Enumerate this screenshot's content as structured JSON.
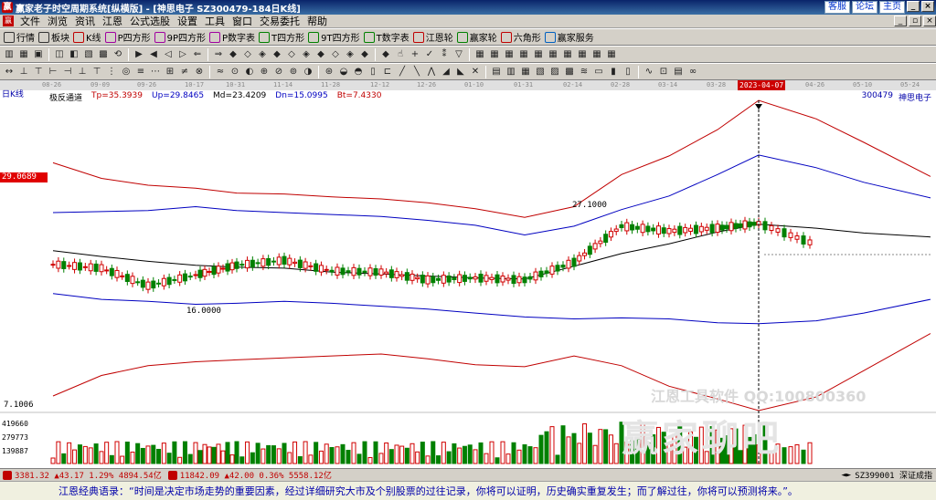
{
  "window": {
    "title": "赢家老子时空周期系统[纵横版] - [神思电子   SZ300479-184日K线]",
    "links": [
      "客服",
      "论坛",
      "主页"
    ]
  },
  "menu": [
    "文件",
    "浏览",
    "资讯",
    "江恩",
    "公式选股",
    "设置",
    "工具",
    "窗口",
    "交易委托",
    "帮助"
  ],
  "toolbar1": [
    {
      "label": "行情",
      "icon": "grid-icon",
      "color": "#333"
    },
    {
      "label": "板块",
      "icon": "sector-icon",
      "color": "#333"
    },
    {
      "label": "K线",
      "icon": "kline-icon",
      "color": "#c00000"
    },
    {
      "label": "P四方形",
      "icon": "p-square-icon",
      "color": "#a000a0"
    },
    {
      "label": "9P四方形",
      "icon": "9p-square-icon",
      "color": "#a000a0"
    },
    {
      "label": "P数字表",
      "icon": "p-table-icon",
      "color": "#a000a0"
    },
    {
      "label": "T四方形",
      "icon": "t-square-icon",
      "color": "#008000"
    },
    {
      "label": "9T四方形",
      "icon": "9t-square-icon",
      "color": "#008000"
    },
    {
      "label": "T数字表",
      "icon": "t-table-icon",
      "color": "#008000"
    },
    {
      "label": "江恩轮",
      "icon": "gann-wheel-icon",
      "color": "#c00000"
    },
    {
      "label": "赢家轮",
      "icon": "winner-wheel-icon",
      "color": "#008000"
    },
    {
      "label": "六角形",
      "icon": "hexagon-icon",
      "color": "#c00000"
    },
    {
      "label": "赢家服务",
      "icon": "service-icon",
      "color": "#0060c0"
    }
  ],
  "chart": {
    "period_label": "日K线",
    "indicator": {
      "name": "极反通道",
      "tp": "Tp=35.3939",
      "up": "Up=29.8465",
      "md": "Md=23.4209",
      "dn": "Dn=15.0995",
      "bt": "Bt=7.4330"
    },
    "stock_code": "300479",
    "stock_name": "神思电子",
    "price_tag": "29.0689",
    "high_label": "27.1000",
    "low_label": "16.0000",
    "bottom_price": "7.1006",
    "highlight_date": "2023-04-07",
    "dates": [
      "08-26",
      "09-09",
      "09-26",
      "10-17",
      "10-31",
      "11-14",
      "11-28",
      "12-12",
      "12-26",
      "01-10",
      "01-31",
      "02-14",
      "02-28",
      "03-14",
      "03-28",
      "04-26",
      "05-10",
      "05-24"
    ],
    "volume_labels": [
      "419660",
      "279773",
      "139887"
    ],
    "watermark_line": "江恩工具软件  QQ:100800360",
    "watermark_big": "赢家聊吧"
  },
  "chart_data": {
    "type": "candlestick",
    "title": "",
    "ohlc_note": "daily K-line with Gann-style channel bands",
    "series": [
      {
        "name": "Tp",
        "color": "#c00000"
      },
      {
        "name": "Up",
        "color": "#0000c0"
      },
      {
        "name": "Md",
        "color": "#000000"
      },
      {
        "name": "Dn",
        "color": "#0000c0"
      },
      {
        "name": "Bt",
        "color": "#c00000"
      }
    ],
    "x": [
      "08-26",
      "09-09",
      "09-26",
      "10-17",
      "10-31",
      "11-14",
      "11-28",
      "12-12",
      "12-26",
      "01-10",
      "01-31",
      "02-14",
      "02-28",
      "03-14",
      "03-28",
      "04-07",
      "04-26",
      "05-10",
      "05-24"
    ],
    "close": [
      20.6,
      20.2,
      18.4,
      19.5,
      20.5,
      21.0,
      19.9,
      19.8,
      19.0,
      19.2,
      19.0,
      20.8,
      24.5,
      24.0,
      24.3,
      24.8,
      22.6,
      null,
      null
    ],
    "md": [
      22.0,
      21.4,
      20.9,
      20.5,
      20.3,
      20.2,
      19.8,
      19.6,
      19.4,
      19.2,
      19.1,
      20.4,
      21.7,
      22.7,
      23.9,
      24.7,
      24.3,
      23.8,
      23.4
    ],
    "up": [
      25.9,
      26.0,
      26.1,
      26.5,
      26.1,
      25.9,
      25.7,
      25.5,
      25.1,
      24.6,
      23.6,
      24.5,
      26.2,
      27.6,
      29.8,
      31.8,
      30.5,
      29.0,
      27.4
    ],
    "tp": [
      31.0,
      29.4,
      28.7,
      28.4,
      27.9,
      27.8,
      27.5,
      27.3,
      26.9,
      26.3,
      25.4,
      26.5,
      29.8,
      31.7,
      34.4,
      37.4,
      35.5,
      33.1,
      29.6
    ],
    "dn": [
      17.6,
      17.0,
      16.8,
      16.5,
      16.6,
      16.8,
      16.6,
      16.3,
      16.0,
      15.6,
      15.2,
      15.0,
      15.1,
      15.0,
      14.6,
      14.5,
      14.8,
      15.6,
      17.0
    ],
    "bt": [
      7.1,
      9.2,
      10.2,
      10.6,
      10.8,
      11.0,
      11.2,
      11.4,
      10.9,
      10.3,
      10.1,
      11.2,
      10.2,
      8.1,
      6.8,
      5.6,
      7.0,
      9.7,
      13.5
    ],
    "volume_axis": [
      419660,
      279773,
      139887
    ]
  },
  "status": {
    "sh": "3381.32 ▲43.17 1.29% 4894.54亿",
    "sz": "11842.09 ▲42.00 0.36% 5558.12亿",
    "right_code": "SZ399001 深证成指"
  },
  "footer": "江恩经典语录：“时间是决定市场走势的重要因素，经过详细研究大市及个别股票的过往记录，你将可以证明，历史确实重复发生；而了解过往，你将可以预测将来。”。"
}
